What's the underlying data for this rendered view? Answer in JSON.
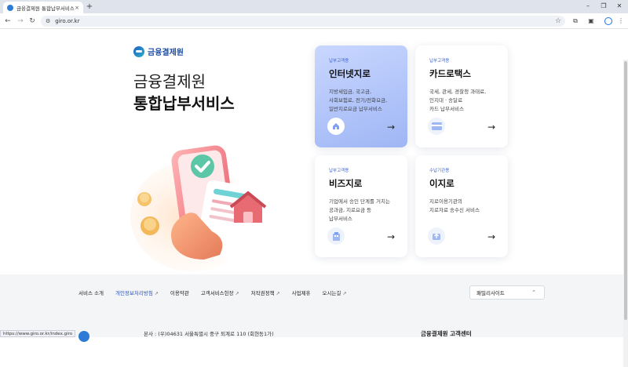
{
  "browser": {
    "tab_title": "금융결제원 통합납부서비스",
    "tab_close": "×",
    "new_tab": "+",
    "url": "giro.or.kr",
    "win_minimize": "–",
    "win_restore": "❐",
    "win_close": "✕"
  },
  "header": {
    "logo_text": "금융결제원",
    "title_line1": "금융결제원",
    "title_line2": "통합납부서비스"
  },
  "cards": [
    {
      "tag": "납부고객용",
      "title": "인터넷지로",
      "desc": [
        "지방세입금, 국고금,",
        "사회보험료, 전기/전화요금,",
        "일반지로요금 납부서비스"
      ],
      "icon": "home-icon",
      "arrow": "→"
    },
    {
      "tag": "납부고객용",
      "title": "카드로택스",
      "desc": [
        "국세, 관세, 경찰청 과태료,",
        "인지대 · 송달료",
        "카드 납부서비스"
      ],
      "icon": "card-icon",
      "arrow": "→"
    },
    {
      "tag": "납부고객용",
      "title": "비즈지로",
      "desc": [
        "기업에서 승인 단계를 거치는",
        "공과금, 지로요금 등",
        "납부서비스"
      ],
      "icon": "building-icon",
      "arrow": "→"
    },
    {
      "tag": "수납기관용",
      "title": "이지로",
      "desc": [
        "지로이용기관의",
        "지로자료 송수신 서비스"
      ],
      "icon": "upload-icon",
      "arrow": "→"
    }
  ],
  "footer": {
    "nav": [
      {
        "label": "서비스 소개",
        "ext": false,
        "highlight": false
      },
      {
        "label": "개인정보처리방침",
        "ext": true,
        "highlight": true
      },
      {
        "label": "이용약관",
        "ext": false,
        "highlight": false
      },
      {
        "label": "고객서비스헌장",
        "ext": true,
        "highlight": false
      },
      {
        "label": "저작권정책",
        "ext": true,
        "highlight": false
      },
      {
        "label": "사업제휴",
        "ext": false,
        "highlight": false
      },
      {
        "label": "오시는길",
        "ext": true,
        "highlight": false
      }
    ],
    "ext_icon": "↗",
    "family_site": "패밀리사이트",
    "family_chevron": "⌃",
    "address": "본사 : (우)04631 서울특별시 중구 퇴계로 110 (회현동1가)",
    "center_title": "금융결제원 고객센터"
  },
  "status_url": "https://www.giro.or.kr/index.giro",
  "colors": {
    "accent": "#2456c9",
    "card_active_top": "#c9d7ff",
    "card_active_bottom": "#9fb6f5",
    "footer_bg": "#f4f5f7"
  }
}
